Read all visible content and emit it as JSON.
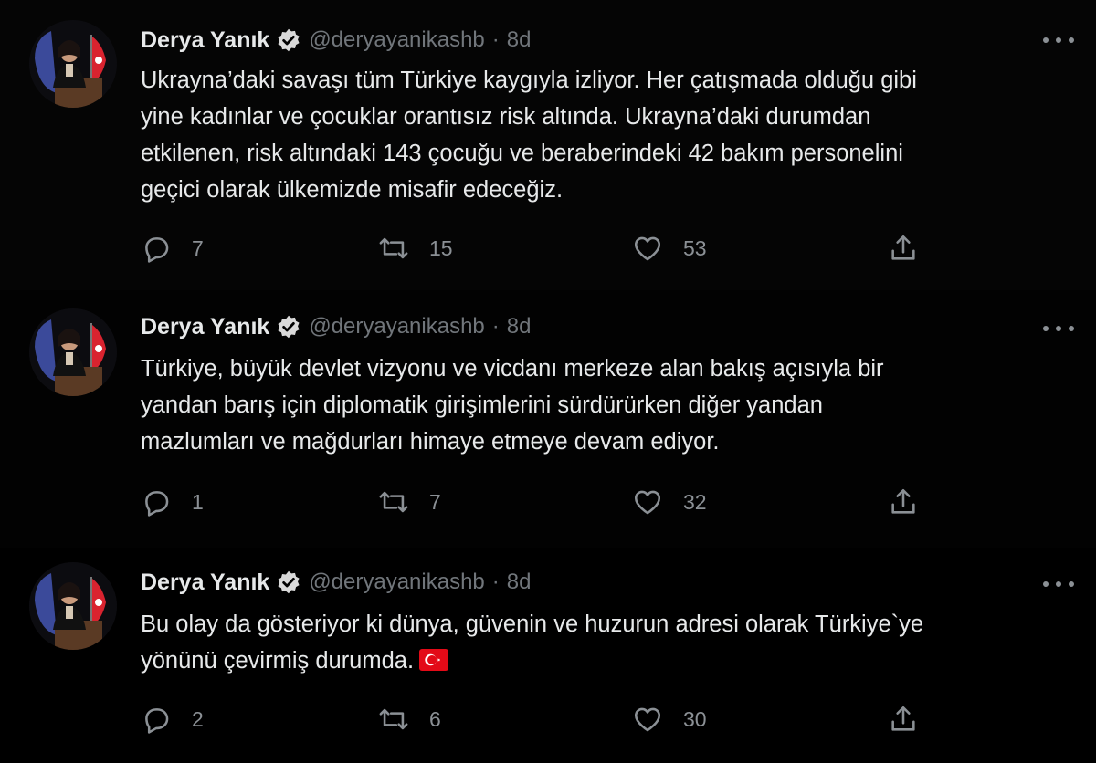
{
  "tweets": [
    {
      "author": {
        "name": "Derya Yanık",
        "handle": "@deryayanikashb",
        "verified": true
      },
      "separator": "·",
      "time": "8d",
      "lines": [
        "Ukrayna’daki savaşı tüm Türkiye kaygıyla izliyor. Her çatışmada olduğu gibi",
        "yine kadınlar ve çocuklar orantısız risk altında. Ukrayna’daki durumdan",
        "etkilenen, risk altındaki 143 çocuğu ve beraberindeki 42 bakım personelini",
        "geçici olarak ülkemizde misafir edeceğiz."
      ],
      "stats": {
        "replies": "7",
        "retweets": "15",
        "likes": "53"
      }
    },
    {
      "author": {
        "name": "Derya Yanık",
        "handle": "@deryayanikashb",
        "verified": true
      },
      "separator": "·",
      "time": "8d",
      "lines": [
        "Türkiye, büyük devlet vizyonu ve vicdanı merkeze alan bakış açısıyla bir",
        "yandan barış için diplomatik girişimlerini sürdürürken diğer yandan",
        "mazlumları ve mağdurları himaye etmeye devam ediyor."
      ],
      "stats": {
        "replies": "1",
        "retweets": "7",
        "likes": "32"
      }
    },
    {
      "author": {
        "name": "Derya Yanık",
        "handle": "@deryayanikashb",
        "verified": true
      },
      "separator": "·",
      "time": "8d",
      "lines": [
        "Bu olay da gösteriyor ki dünya, güvenin ve huzurun adresi olarak Türkiye`ye",
        "yönünü çevirmiş durumda."
      ],
      "emoji": "turkey-flag",
      "stats": {
        "replies": "2",
        "retweets": "6",
        "likes": "30"
      }
    }
  ],
  "icons": {
    "reply": "reply-icon",
    "retweet": "retweet-icon",
    "like": "like-icon",
    "share": "share-icon",
    "more": "more-icon",
    "verified": "verified-badge-icon"
  },
  "colors": {
    "background": "#000000",
    "text_primary": "#e7e9ea",
    "text_secondary": "#71767b",
    "thread_line": "#333639",
    "flag_red": "#e30a17"
  }
}
